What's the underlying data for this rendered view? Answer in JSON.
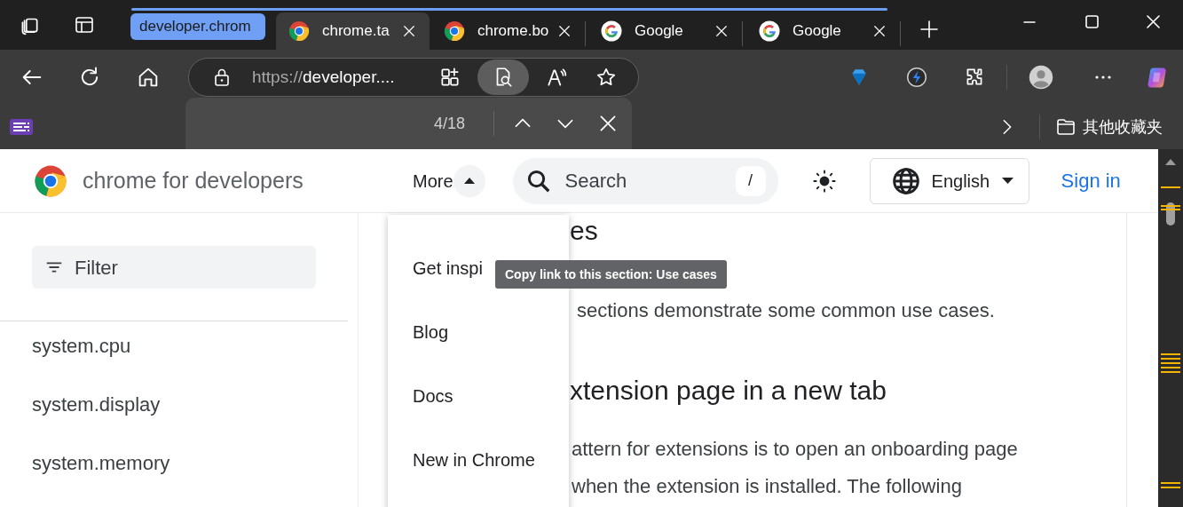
{
  "browser": {
    "tab_group": {
      "label": "developer.chrom"
    },
    "tabs": [
      {
        "title": "chrome.ta",
        "kind": "chrome",
        "selected": true
      },
      {
        "title": "chrome.bo",
        "kind": "chrome",
        "selected": false
      },
      {
        "title": "Google",
        "kind": "google",
        "selected": false
      },
      {
        "title": "Google",
        "kind": "google",
        "selected": false
      }
    ],
    "address_bar": {
      "scheme": "https://",
      "host": "developer...."
    },
    "bookmarks_bar": {
      "other_folder": "其他收藏夹"
    },
    "find_bar": {
      "open": true,
      "count": "4/18"
    }
  },
  "page": {
    "site_name": "chrome for developers",
    "nav_more": {
      "label": "More",
      "expanded": true
    },
    "search": {
      "placeholder": "Search",
      "shortcut": "/"
    },
    "language": "English",
    "sign_in": "Sign in",
    "sidebar": {
      "filter_placeholder": "Filter",
      "items": [
        "system.cpu",
        "system.display",
        "system.memory"
      ]
    },
    "content": [
      {
        "kind": "heading",
        "text": "es"
      },
      {
        "kind": "line",
        "text": "sections demonstrate some common use cases."
      },
      {
        "kind": "heading",
        "text": "xtension page in a new tab"
      },
      {
        "kind": "line",
        "text": "attern for extensions is to open an onboarding page"
      },
      {
        "kind": "line",
        "text": "when the extension is installed. The following"
      }
    ],
    "more_menu": {
      "items": [
        "Get inspi",
        "Blog",
        "Docs",
        "New in Chrome"
      ]
    },
    "tooltip": "Copy link to this section: Use cases"
  }
}
